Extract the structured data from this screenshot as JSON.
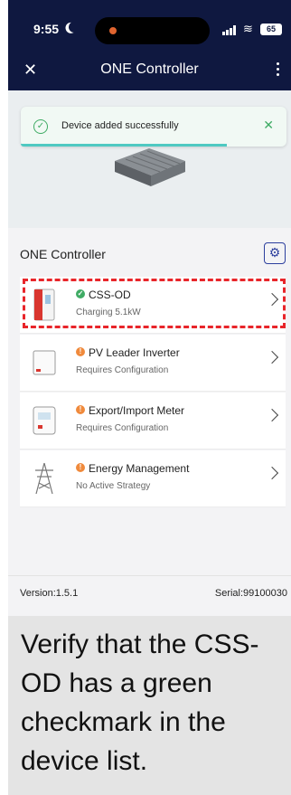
{
  "status_bar": {
    "time": "9:55",
    "battery": "65"
  },
  "app_bar": {
    "title": "ONE Controller"
  },
  "toast": {
    "message": "Device added successfully"
  },
  "section": {
    "title": "ONE Controller"
  },
  "devices": [
    {
      "name": "CSS-OD",
      "status": "Charging 5.1kW",
      "state": "ok",
      "icon": "battery-cabinet-icon"
    },
    {
      "name": "PV Leader Inverter",
      "status": "Requires Configuration",
      "state": "warning",
      "icon": "inverter-icon"
    },
    {
      "name": "Export/Import Meter",
      "status": "Requires Configuration",
      "state": "warning",
      "icon": "meter-icon"
    },
    {
      "name": "Energy Management",
      "status": "No Active Strategy",
      "state": "warning",
      "icon": "transmission-tower-icon"
    }
  ],
  "footer": {
    "version": "Version:1.5.1",
    "serial": "Serial:99100030"
  },
  "caption": {
    "text": "Verify that the CSS-OD has a green checkmark in the device list."
  },
  "colors": {
    "app_bar": "#0f1840",
    "ok": "#3fab64",
    "warning": "#f08a3c",
    "highlight": "#e8252a",
    "accent": "#2c3f9e"
  }
}
